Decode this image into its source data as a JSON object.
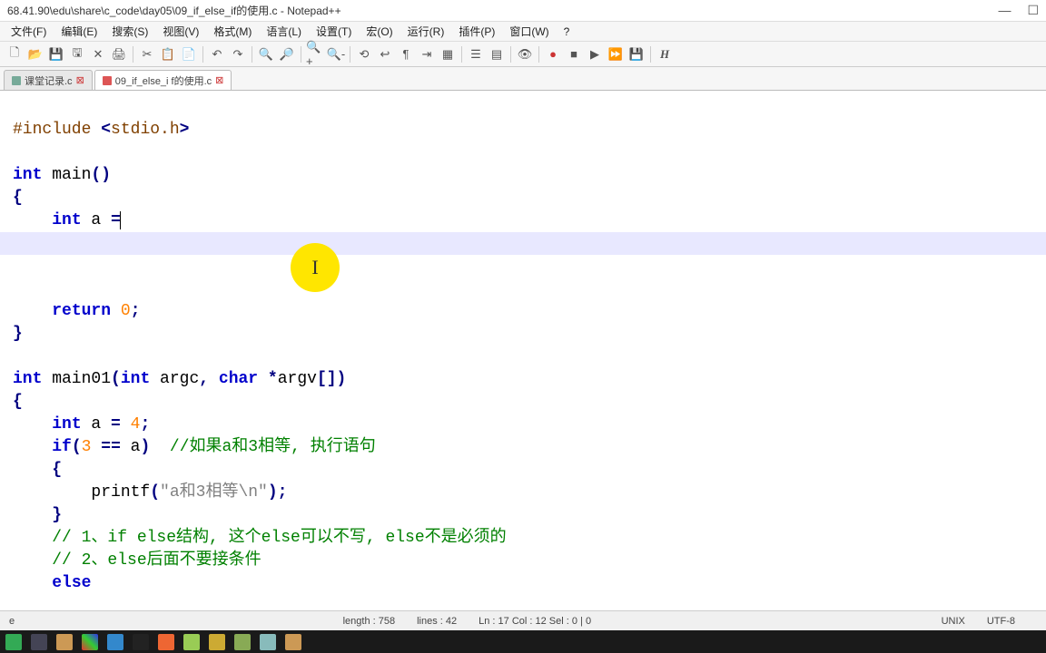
{
  "title": "68.41.90\\edu\\share\\c_code\\day05\\09_if_else_if的使用.c - Notepad++",
  "menu": [
    "文件(F)",
    "编辑(E)",
    "搜索(S)",
    "视图(V)",
    "格式(M)",
    "语言(L)",
    "设置(T)",
    "宏(O)",
    "运行(R)",
    "插件(P)",
    "窗口(W)",
    "?"
  ],
  "tabs": [
    {
      "label": "课堂记录.c",
      "active": false
    },
    {
      "label": "09_if_else_i f的使用.c",
      "active": true
    }
  ],
  "code_html": "#include &lt;stdio.h&gt;\n\nint main()\n{\n    int a =\n\n\n\n    return 0;\n}\n\nint main01(int argc, char *argv[])\n{\n    int a = 4;\n    if(3 == a)  //如果a和3相等, 执行语句\n    {\n        printf(\"a和3相等\\n\");\n    }\n    // 1、if else结构, 这个else可以不写, else不是必须的\n    // 2、else后面不要接条件\n    else",
  "status": {
    "left": "e",
    "length": "length : 758",
    "lines": "lines : 42",
    "pos": "Ln : 17   Col : 12   Sel : 0 | 0",
    "eol": "UNIX",
    "enc": "UTF-8"
  }
}
